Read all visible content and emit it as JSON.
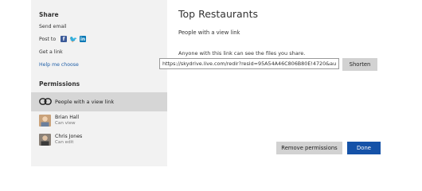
{
  "sidebar": {
    "share_heading": "Share",
    "send_email": "Send email",
    "post_to": "Post to",
    "social_icons": [
      "facebook-icon",
      "twitter-icon",
      "linkedin-icon"
    ],
    "get_link": "Get a link",
    "help": "Help me choose",
    "permissions_heading": "Permissions",
    "selected_permission": "People with a view link",
    "people": [
      {
        "name": "Brian Hall",
        "role": "Can view"
      },
      {
        "name": "Chris Jones",
        "role": "Can edit"
      }
    ]
  },
  "main": {
    "title": "Top Restaurants",
    "subtitle": "People with a view link",
    "description": "Anyone with this link can see the files you share.",
    "url_value": "https://skydrive.live.com/redir?resid=95A54A46C806B80E!4720&au",
    "shorten_label": "Shorten",
    "remove_label": "Remove permissions",
    "done_label": "Done"
  },
  "colors": {
    "sidebar_bg": "#f2f2f2",
    "selected_row_bg": "#d6d6d6",
    "accent_blue": "#1552a8",
    "link_blue": "#1f5fa8"
  }
}
